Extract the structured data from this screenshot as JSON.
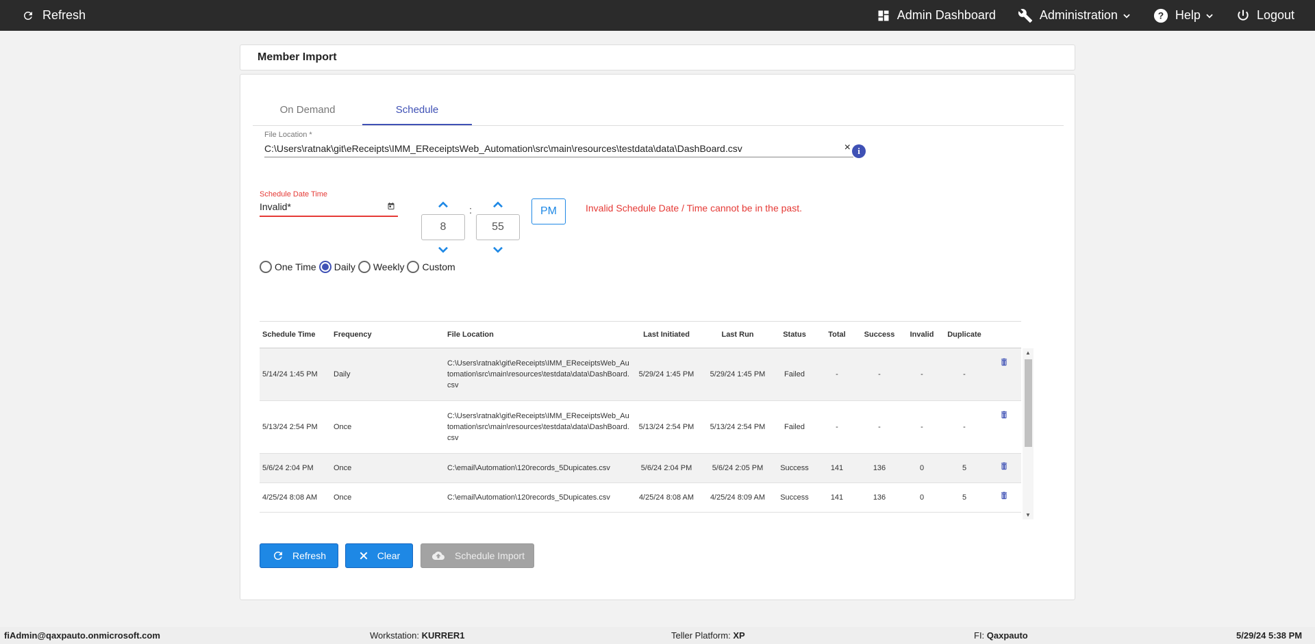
{
  "topbar": {
    "refresh_label": "Refresh",
    "admin_dashboard_label": "Admin Dashboard",
    "administration_label": "Administration",
    "help_label": "Help",
    "logout_label": "Logout"
  },
  "page": {
    "title": "Member Import"
  },
  "tabs": [
    {
      "label": "On Demand"
    },
    {
      "label": "Schedule"
    }
  ],
  "form": {
    "file_location_label": "File Location *",
    "file_location_value": "C:\\Users\\ratnak\\git\\eReceipts\\IMM_EReceiptsWeb_Automation\\src\\main\\resources\\testdata\\data\\DashBoard.csv",
    "clear_glyph": "×",
    "info_glyph": "i",
    "schedule_date_label": "Schedule Date Time",
    "schedule_date_value": "Invalid*",
    "hour": "8",
    "colon": ":",
    "minute": "55",
    "ampm": "PM",
    "error_message": "Invalid Schedule Date / Time cannot be in the past.",
    "frequency_options": [
      "One Time",
      "Daily",
      "Weekly",
      "Custom"
    ],
    "frequency_selected": "Daily"
  },
  "table": {
    "headers": {
      "schedule_time": "Schedule Time",
      "frequency": "Frequency",
      "file_location": "File Location",
      "last_initiated": "Last Initiated",
      "last_run": "Last Run",
      "status": "Status",
      "total": "Total",
      "success": "Success",
      "invalid": "Invalid",
      "duplicate": "Duplicate"
    },
    "rows": [
      {
        "schedule_time": "5/14/24 1:45 PM",
        "frequency": "Daily",
        "file_location": "C:\\Users\\ratnak\\git\\eReceipts\\IMM_EReceiptsWeb_Automation\\src\\main\\resources\\testdata\\data\\DashBoard.csv",
        "last_initiated": "5/29/24 1:45 PM",
        "last_run": "5/29/24 1:45 PM",
        "status": "Failed",
        "total": "-",
        "success": "-",
        "invalid": "-",
        "duplicate": "-"
      },
      {
        "schedule_time": "5/13/24 2:54 PM",
        "frequency": "Once",
        "file_location": "C:\\Users\\ratnak\\git\\eReceipts\\IMM_EReceiptsWeb_Automation\\src\\main\\resources\\testdata\\data\\DashBoard.csv",
        "last_initiated": "5/13/24 2:54 PM",
        "last_run": "5/13/24 2:54 PM",
        "status": "Failed",
        "total": "-",
        "success": "-",
        "invalid": "-",
        "duplicate": "-"
      },
      {
        "schedule_time": "5/6/24 2:04 PM",
        "frequency": "Once",
        "file_location": "C:\\email\\Automation\\120records_5Dupicates.csv",
        "last_initiated": "5/6/24 2:04 PM",
        "last_run": "5/6/24 2:05 PM",
        "status": "Success",
        "total": "141",
        "success": "136",
        "invalid": "0",
        "duplicate": "5"
      },
      {
        "schedule_time": "4/25/24 8:08 AM",
        "frequency": "Once",
        "file_location": "C:\\email\\Automation\\120records_5Dupicates.csv",
        "last_initiated": "4/25/24 8:08 AM",
        "last_run": "4/25/24 8:09 AM",
        "status": "Success",
        "total": "141",
        "success": "136",
        "invalid": "0",
        "duplicate": "5"
      }
    ]
  },
  "buttons": {
    "refresh": "Refresh",
    "clear": "Clear",
    "schedule_import": "Schedule Import"
  },
  "footer": {
    "user": "fiAdmin@qaxpauto.onmicrosoft.com",
    "workstation_label": "Workstation:",
    "workstation_value": "KURRER1",
    "teller_label": "Teller Platform:",
    "teller_value": "XP",
    "fi_label": "FI:",
    "fi_value": "Qaxpauto",
    "datetime": "5/29/24 5:38 PM"
  },
  "colors": {
    "topbar": "#2b2b2b",
    "accent": "#3f51b5",
    "button": "#1e88e5",
    "error": "#e53935"
  }
}
